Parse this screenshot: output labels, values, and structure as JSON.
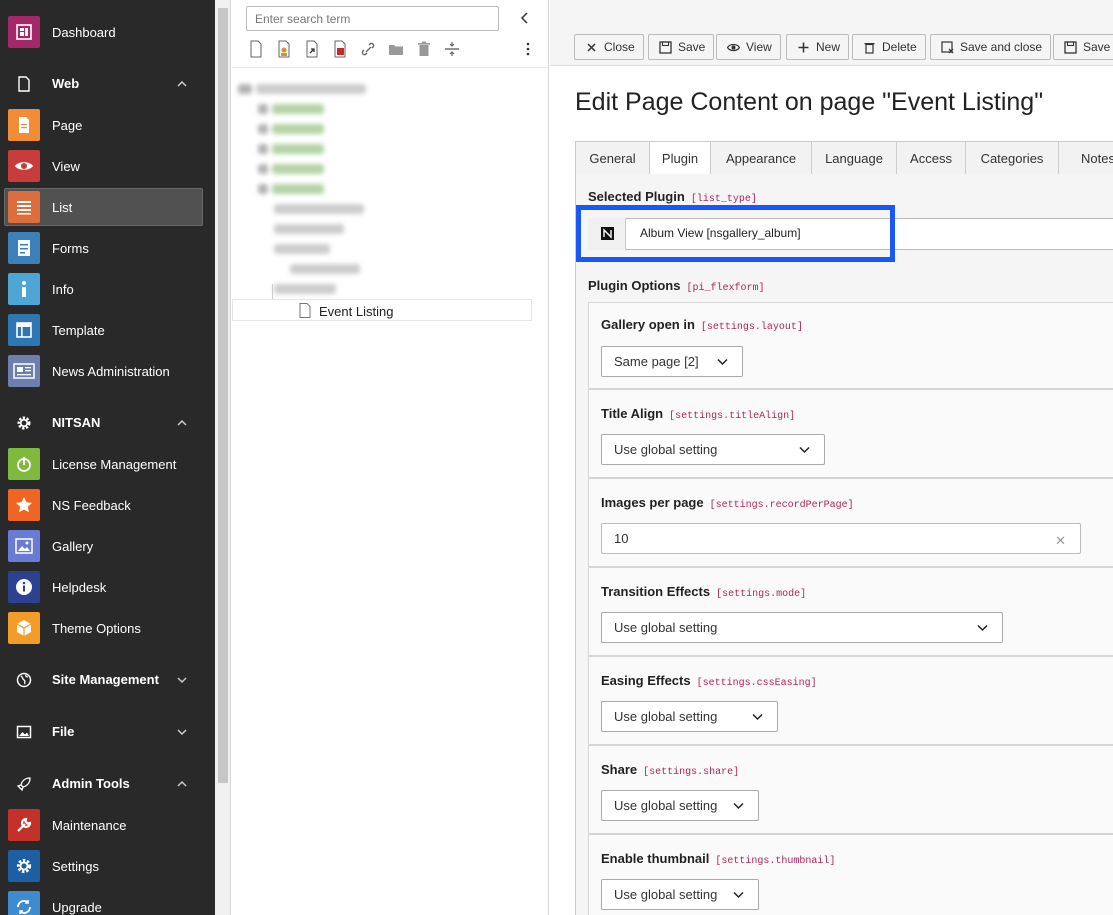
{
  "sidebar": {
    "dashboard": "Dashboard",
    "groups": {
      "web": "Web",
      "nitsan": "NITSAN",
      "site_management": "Site Management",
      "file": "File",
      "admin_tools": "Admin Tools"
    },
    "modules": {
      "page": "Page",
      "view": "View",
      "list": "List",
      "forms": "Forms",
      "info": "Info",
      "template": "Template",
      "news_administration": "News Administration",
      "license_management": "License Management",
      "ns_feedback": "NS Feedback",
      "gallery": "Gallery",
      "helpdesk": "Helpdesk",
      "theme_options": "Theme Options",
      "maintenance": "Maintenance",
      "settings": "Settings",
      "upgrade": "Upgrade"
    },
    "colors": {
      "dashboard": "#a4276a",
      "page": "#f18c38",
      "view": "#c83c3c",
      "list": "#dc6d3c",
      "forms": "#3d7fb8",
      "info": "#4da6d6",
      "template": "#2f77b2",
      "news": "#6d80ad",
      "license": "#7fba3c",
      "feedback": "#f06424",
      "gallery": "#6b7bd4",
      "helpdesk": "#2c4190",
      "theme": "#f39c27",
      "maintenance": "#c4312a",
      "settings": "#1d5fa3",
      "upgrade": "#3f8bd0"
    }
  },
  "tree": {
    "search_placeholder": "Enter search term",
    "selected_page": "Event Listing"
  },
  "toolbar": {
    "close": "Close",
    "save": "Save",
    "view": "View",
    "new": "New",
    "delete": "Delete",
    "save_and_close": "Save and close",
    "save_partial": "Save"
  },
  "page_title": "Edit Page Content on page \"Event Listing\"",
  "tabs": [
    "General",
    "Plugin",
    "Appearance",
    "Language",
    "Access",
    "Categories",
    "Notes"
  ],
  "form": {
    "selected_plugin": {
      "label": "Selected Plugin",
      "key": "[list_type]",
      "value": "Album View [nsgallery_album]"
    },
    "plugin_options": {
      "label": "Plugin Options",
      "key": "[pi_flexform]"
    },
    "fields": [
      {
        "label": "Gallery open in",
        "key": "[settings.layout]",
        "value": "Same page [2]"
      },
      {
        "label": "Title Align",
        "key": "[settings.titleAlign]",
        "value": "Use global setting"
      },
      {
        "label": "Images per page",
        "key": "[settings.recordPerPage]",
        "value": "10"
      },
      {
        "label": "Transition Effects",
        "key": "[settings.mode]",
        "value": "Use global setting"
      },
      {
        "label": "Easing Effects",
        "key": "[settings.cssEasing]",
        "value": "Use global setting"
      },
      {
        "label": "Share",
        "key": "[settings.share]",
        "value": "Use global setting"
      },
      {
        "label": "Enable thumbnail",
        "key": "[settings.thumbnail]",
        "value": "Use global setting"
      }
    ],
    "highlight_color": "#1958f5"
  }
}
